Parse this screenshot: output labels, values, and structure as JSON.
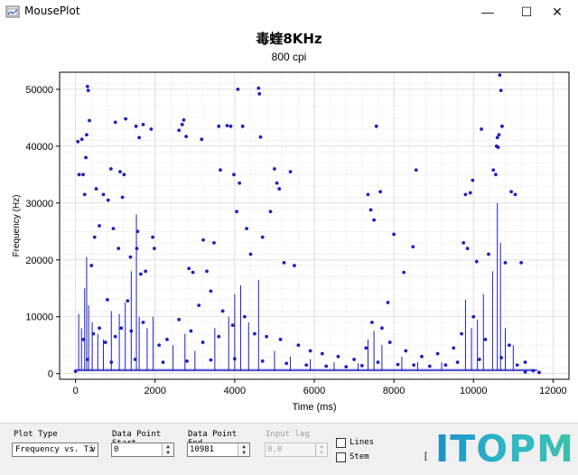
{
  "window": {
    "title": "MousePlot",
    "minimize_label": "—",
    "maximize_label": "☐",
    "close_label": "✕"
  },
  "chart_header": {
    "title": "毒蝰8KHz",
    "subtitle": "800 cpi"
  },
  "controls": {
    "plot_type": {
      "label": "Plot Type",
      "value": "Frequency vs. Ti"
    },
    "start": {
      "label": "Data Point Start",
      "value": "0"
    },
    "end": {
      "label": "Data Point End",
      "value": "10981"
    },
    "input_lag": {
      "label": "Input lag",
      "value": "0.0",
      "enabled": false
    },
    "lines": {
      "label": "Lines",
      "checked": false
    },
    "stem": {
      "label": "Stem",
      "checked": false
    },
    "bracket": "["
  },
  "watermark": {
    "text": "ITOPM",
    "colors": [
      "#1c8fc4",
      "#2db7c9",
      "#3dc0a8"
    ]
  },
  "colors": {
    "series": "#1f1fbf",
    "line": "#1f1fbf",
    "grid": "#ececec",
    "axis": "#000000"
  },
  "chart_data": {
    "type": "scatter",
    "title": "毒蝰8KHz",
    "subtitle": "800 cpi",
    "xlabel": "Time (ms)",
    "ylabel": "Frequency (Hz)",
    "xlim": [
      -400,
      12400
    ],
    "ylim": [
      -1000,
      53000
    ],
    "xticks": [
      0,
      2000,
      4000,
      6000,
      8000,
      10000,
      12000
    ],
    "yticks": [
      0,
      10000,
      20000,
      30000,
      40000,
      50000
    ],
    "grid": true,
    "stems": [
      {
        "x": 80,
        "y": 10500
      },
      {
        "x": 150,
        "y": 8000
      },
      {
        "x": 230,
        "y": 15000
      },
      {
        "x": 280,
        "y": 20500
      },
      {
        "x": 330,
        "y": 12000
      },
      {
        "x": 420,
        "y": 9000
      },
      {
        "x": 560,
        "y": 7000
      },
      {
        "x": 700,
        "y": 6000
      },
      {
        "x": 900,
        "y": 11000
      },
      {
        "x": 1100,
        "y": 10500
      },
      {
        "x": 1250,
        "y": 12500
      },
      {
        "x": 1400,
        "y": 18000
      },
      {
        "x": 1530,
        "y": 28000
      },
      {
        "x": 1600,
        "y": 10000
      },
      {
        "x": 1800,
        "y": 8000
      },
      {
        "x": 1950,
        "y": 10000
      },
      {
        "x": 2450,
        "y": 5000
      },
      {
        "x": 2750,
        "y": 7000
      },
      {
        "x": 3000,
        "y": 4000
      },
      {
        "x": 3500,
        "y": 8000
      },
      {
        "x": 3850,
        "y": 10000
      },
      {
        "x": 4000,
        "y": 14000
      },
      {
        "x": 4150,
        "y": 15500
      },
      {
        "x": 4350,
        "y": 9000
      },
      {
        "x": 4600,
        "y": 16500
      },
      {
        "x": 5000,
        "y": 4000
      },
      {
        "x": 5400,
        "y": 3000
      },
      {
        "x": 5900,
        "y": 2500
      },
      {
        "x": 6500,
        "y": 2000
      },
      {
        "x": 7100,
        "y": 1800
      },
      {
        "x": 7350,
        "y": 6000
      },
      {
        "x": 7500,
        "y": 7500
      },
      {
        "x": 7700,
        "y": 5000
      },
      {
        "x": 8200,
        "y": 3000
      },
      {
        "x": 8600,
        "y": 2000
      },
      {
        "x": 9200,
        "y": 2000
      },
      {
        "x": 9800,
        "y": 13000
      },
      {
        "x": 9950,
        "y": 8000
      },
      {
        "x": 10100,
        "y": 9500
      },
      {
        "x": 10250,
        "y": 14000
      },
      {
        "x": 10480,
        "y": 18000
      },
      {
        "x": 10600,
        "y": 30000
      },
      {
        "x": 10680,
        "y": 23000
      },
      {
        "x": 10800,
        "y": 8000
      },
      {
        "x": 11000,
        "y": 5000
      }
    ],
    "points": [
      {
        "x": 60,
        "y": 40800
      },
      {
        "x": 90,
        "y": 35000
      },
      {
        "x": 160,
        "y": 41200
      },
      {
        "x": 190,
        "y": 35000
      },
      {
        "x": 230,
        "y": 31500
      },
      {
        "x": 260,
        "y": 38000
      },
      {
        "x": 280,
        "y": 42000
      },
      {
        "x": 300,
        "y": 50500
      },
      {
        "x": 320,
        "y": 49800
      },
      {
        "x": 350,
        "y": 44500
      },
      {
        "x": 400,
        "y": 19000
      },
      {
        "x": 480,
        "y": 24000
      },
      {
        "x": 520,
        "y": 32500
      },
      {
        "x": 600,
        "y": 26000
      },
      {
        "x": 700,
        "y": 31500
      },
      {
        "x": 800,
        "y": 13000
      },
      {
        "x": 820,
        "y": 30500
      },
      {
        "x": 890,
        "y": 36000
      },
      {
        "x": 950,
        "y": 25500
      },
      {
        "x": 1000,
        "y": 44200
      },
      {
        "x": 1080,
        "y": 22000
      },
      {
        "x": 1120,
        "y": 35500
      },
      {
        "x": 1180,
        "y": 31000
      },
      {
        "x": 1220,
        "y": 35000
      },
      {
        "x": 1260,
        "y": 44800
      },
      {
        "x": 1310,
        "y": 12800
      },
      {
        "x": 1380,
        "y": 20500
      },
      {
        "x": 1520,
        "y": 43500
      },
      {
        "x": 1540,
        "y": 22000
      },
      {
        "x": 1560,
        "y": 25000
      },
      {
        "x": 1600,
        "y": 41500
      },
      {
        "x": 1640,
        "y": 17500
      },
      {
        "x": 1700,
        "y": 43800
      },
      {
        "x": 1760,
        "y": 18000
      },
      {
        "x": 1900,
        "y": 43000
      },
      {
        "x": 1940,
        "y": 24000
      },
      {
        "x": 1980,
        "y": 22000
      },
      {
        "x": 2600,
        "y": 42800
      },
      {
        "x": 2680,
        "y": 43800
      },
      {
        "x": 2720,
        "y": 44600
      },
      {
        "x": 2780,
        "y": 41700
      },
      {
        "x": 2850,
        "y": 18500
      },
      {
        "x": 2950,
        "y": 17800
      },
      {
        "x": 3100,
        "y": 12000
      },
      {
        "x": 3170,
        "y": 41200
      },
      {
        "x": 3210,
        "y": 23500
      },
      {
        "x": 3300,
        "y": 18000
      },
      {
        "x": 3400,
        "y": 14500
      },
      {
        "x": 3480,
        "y": 23000
      },
      {
        "x": 3600,
        "y": 43500
      },
      {
        "x": 3640,
        "y": 35800
      },
      {
        "x": 3700,
        "y": 11000
      },
      {
        "x": 3810,
        "y": 43600
      },
      {
        "x": 3900,
        "y": 43500
      },
      {
        "x": 3980,
        "y": 35000
      },
      {
        "x": 4050,
        "y": 28500
      },
      {
        "x": 4080,
        "y": 50000
      },
      {
        "x": 4120,
        "y": 33500
      },
      {
        "x": 4200,
        "y": 43500
      },
      {
        "x": 4300,
        "y": 25500
      },
      {
        "x": 4400,
        "y": 21000
      },
      {
        "x": 4600,
        "y": 50200
      },
      {
        "x": 4620,
        "y": 49200
      },
      {
        "x": 4650,
        "y": 41600
      },
      {
        "x": 4700,
        "y": 24000
      },
      {
        "x": 4900,
        "y": 28500
      },
      {
        "x": 5000,
        "y": 36000
      },
      {
        "x": 5060,
        "y": 33500
      },
      {
        "x": 5120,
        "y": 32500
      },
      {
        "x": 5240,
        "y": 19500
      },
      {
        "x": 5400,
        "y": 35500
      },
      {
        "x": 5500,
        "y": 19000
      },
      {
        "x": 7350,
        "y": 31500
      },
      {
        "x": 7420,
        "y": 28800
      },
      {
        "x": 7500,
        "y": 27000
      },
      {
        "x": 7560,
        "y": 43500
      },
      {
        "x": 7660,
        "y": 32000
      },
      {
        "x": 7850,
        "y": 12500
      },
      {
        "x": 8000,
        "y": 24500
      },
      {
        "x": 8250,
        "y": 17800
      },
      {
        "x": 8480,
        "y": 22300
      },
      {
        "x": 8560,
        "y": 35800
      },
      {
        "x": 9750,
        "y": 23000
      },
      {
        "x": 9800,
        "y": 31500
      },
      {
        "x": 9850,
        "y": 22000
      },
      {
        "x": 9920,
        "y": 31800
      },
      {
        "x": 9980,
        "y": 34000
      },
      {
        "x": 10080,
        "y": 19700
      },
      {
        "x": 10200,
        "y": 43000
      },
      {
        "x": 10380,
        "y": 21000
      },
      {
        "x": 10500,
        "y": 35800
      },
      {
        "x": 10560,
        "y": 35000
      },
      {
        "x": 10580,
        "y": 40000
      },
      {
        "x": 10600,
        "y": 41500
      },
      {
        "x": 10620,
        "y": 39800
      },
      {
        "x": 10640,
        "y": 42000
      },
      {
        "x": 10660,
        "y": 52500
      },
      {
        "x": 10690,
        "y": 49800
      },
      {
        "x": 10720,
        "y": 43500
      },
      {
        "x": 10800,
        "y": 19500
      },
      {
        "x": 10950,
        "y": 32000
      },
      {
        "x": 11050,
        "y": 31500
      },
      {
        "x": 11200,
        "y": 19500
      },
      {
        "x": 200,
        "y": 6000
      },
      {
        "x": 450,
        "y": 7000
      },
      {
        "x": 600,
        "y": 8000
      },
      {
        "x": 750,
        "y": 5500
      },
      {
        "x": 1000,
        "y": 6500
      },
      {
        "x": 1150,
        "y": 8000
      },
      {
        "x": 1400,
        "y": 7500
      },
      {
        "x": 1700,
        "y": 9000
      },
      {
        "x": 2100,
        "y": 5000
      },
      {
        "x": 2300,
        "y": 6000
      },
      {
        "x": 2600,
        "y": 9500
      },
      {
        "x": 2900,
        "y": 7500
      },
      {
        "x": 3200,
        "y": 5500
      },
      {
        "x": 3600,
        "y": 6500
      },
      {
        "x": 3950,
        "y": 8500
      },
      {
        "x": 4250,
        "y": 10000
      },
      {
        "x": 4500,
        "y": 7000
      },
      {
        "x": 4800,
        "y": 6500
      },
      {
        "x": 5150,
        "y": 6000
      },
      {
        "x": 5600,
        "y": 5000
      },
      {
        "x": 5900,
        "y": 4000
      },
      {
        "x": 6200,
        "y": 3500
      },
      {
        "x": 6600,
        "y": 3000
      },
      {
        "x": 7000,
        "y": 2500
      },
      {
        "x": 7300,
        "y": 4500
      },
      {
        "x": 7450,
        "y": 9000
      },
      {
        "x": 7700,
        "y": 8000
      },
      {
        "x": 7900,
        "y": 5500
      },
      {
        "x": 8300,
        "y": 4000
      },
      {
        "x": 8700,
        "y": 3000
      },
      {
        "x": 9100,
        "y": 3500
      },
      {
        "x": 9500,
        "y": 4500
      },
      {
        "x": 9700,
        "y": 7000
      },
      {
        "x": 10000,
        "y": 10000
      },
      {
        "x": 10300,
        "y": 6000
      },
      {
        "x": 10900,
        "y": 5000
      },
      {
        "x": 11300,
        "y": 2000
      },
      {
        "x": 11500,
        "y": 500
      },
      {
        "x": 11650,
        "y": 200
      },
      {
        "x": 300,
        "y": 2500
      },
      {
        "x": 900,
        "y": 2000
      },
      {
        "x": 1500,
        "y": 2500
      },
      {
        "x": 2200,
        "y": 2000
      },
      {
        "x": 2800,
        "y": 2200
      },
      {
        "x": 3400,
        "y": 2400
      },
      {
        "x": 4000,
        "y": 2600
      },
      {
        "x": 4700,
        "y": 2200
      },
      {
        "x": 5300,
        "y": 1800
      },
      {
        "x": 5800,
        "y": 1500
      },
      {
        "x": 6300,
        "y": 1300
      },
      {
        "x": 6800,
        "y": 1200
      },
      {
        "x": 7200,
        "y": 1400
      },
      {
        "x": 7600,
        "y": 2000
      },
      {
        "x": 8100,
        "y": 1600
      },
      {
        "x": 8500,
        "y": 1500
      },
      {
        "x": 8900,
        "y": 1300
      },
      {
        "x": 9300,
        "y": 1500
      },
      {
        "x": 9600,
        "y": 2000
      },
      {
        "x": 10150,
        "y": 2500
      },
      {
        "x": 10700,
        "y": 2800
      },
      {
        "x": 11100,
        "y": 1500
      },
      {
        "x": 0,
        "y": 400
      },
      {
        "x": 11300,
        "y": 300
      }
    ]
  }
}
